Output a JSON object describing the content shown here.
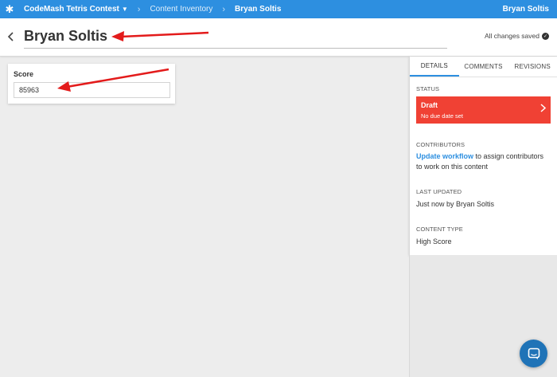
{
  "nav": {
    "project": "CodeMash Tetris Contest",
    "crumbs": [
      "Content Inventory",
      "Bryan Soltis"
    ],
    "user": "Bryan Soltis"
  },
  "header": {
    "title": "Bryan Soltis",
    "saved": "All changes saved"
  },
  "form": {
    "score_label": "Score",
    "score_value": "85963"
  },
  "panel": {
    "tabs": [
      "DETAILS",
      "COMMENTS",
      "REVISIONS"
    ],
    "status_heading": "STATUS",
    "status_title": "Draft",
    "status_sub": "No due date set",
    "contributors_heading": "CONTRIBUTORS",
    "contributors_link": "Update workflow",
    "contributors_text": " to assign contributors to work on this content",
    "updated_heading": "LAST UPDATED",
    "updated_text": "Just now by Bryan Soltis",
    "type_heading": "CONTENT TYPE",
    "type_text": "High Score"
  },
  "colors": {
    "brand": "#2d8fe0",
    "status": "#f04134",
    "annotation": "#e31b1b"
  },
  "icons": {
    "logo": "asterisk-logo-icon",
    "back": "chevron-left-icon",
    "saved": "check-circle-icon",
    "status": "chevron-right-icon",
    "chat": "chat-bubble-icon"
  }
}
